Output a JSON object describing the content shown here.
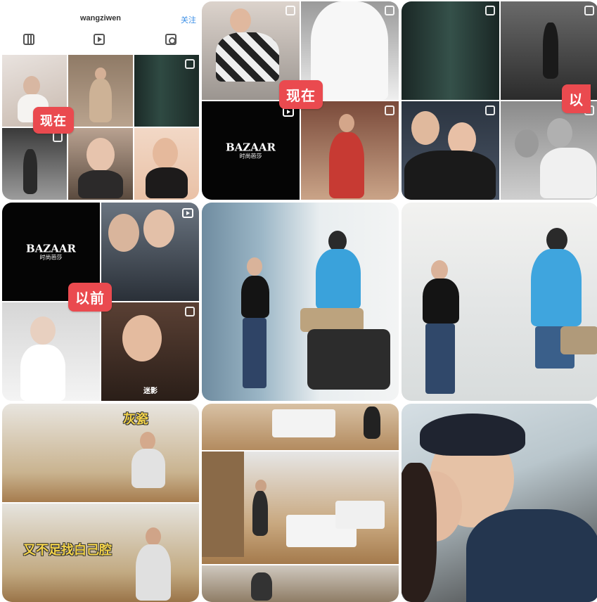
{
  "profile": {
    "username": "wangziwen",
    "follow_label": "关注",
    "tab_icons": [
      "grid-icon",
      "reels-icon",
      "tagged-icon"
    ]
  },
  "tags": {
    "now": "现在",
    "before": "以前",
    "before_partial": "以"
  },
  "magazine": {
    "title": "BAZAAR",
    "subtitle": "时尚芭莎"
  },
  "captions": {
    "ceiling": "灰瓷",
    "subtitle_line": "又不足找白己腔",
    "watermark": "迷影"
  },
  "colors": {
    "tag_bg": "#ea4a4f",
    "follow_text": "#3a8ee6"
  }
}
